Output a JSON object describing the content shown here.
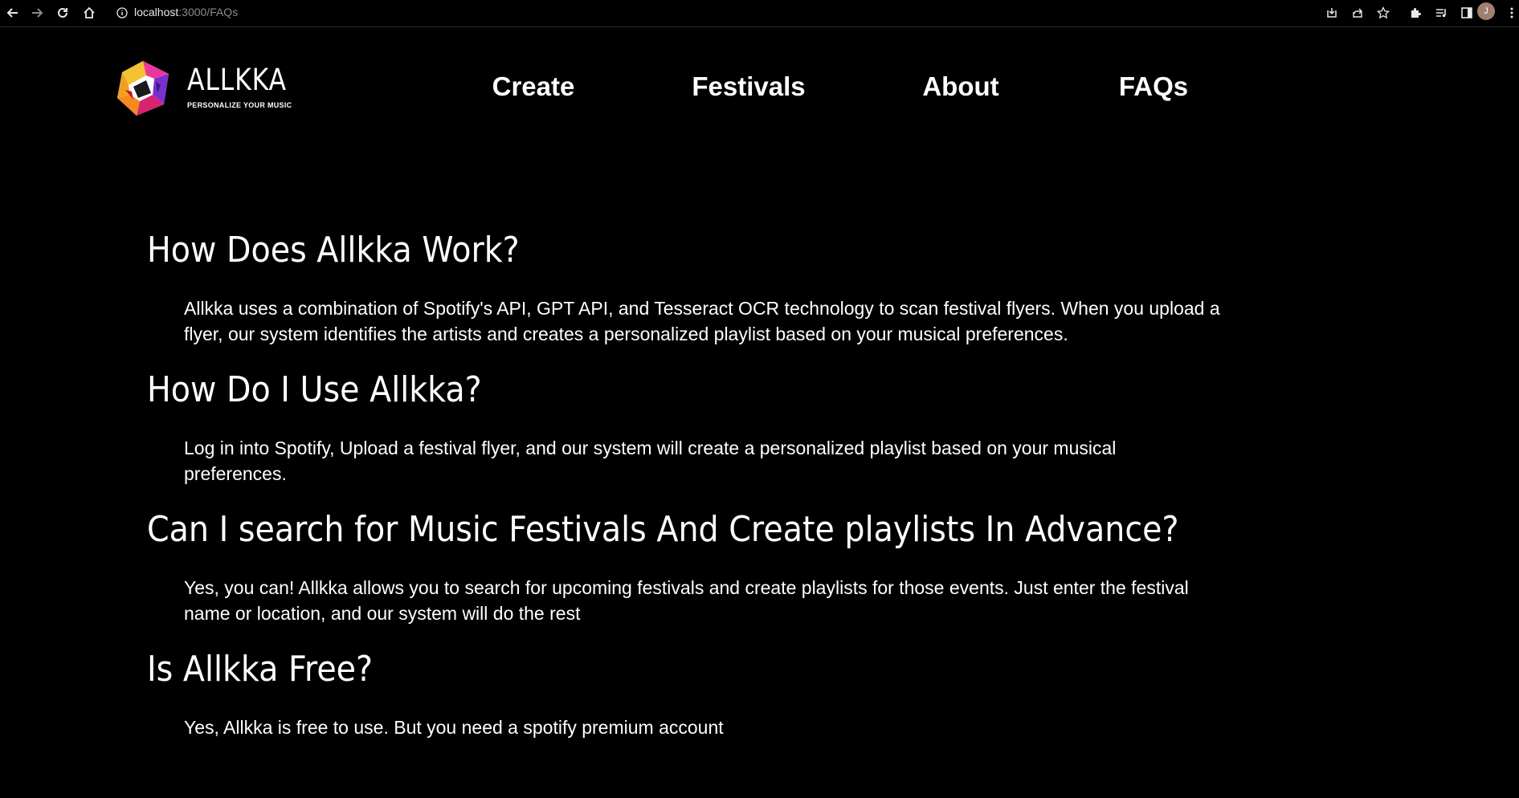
{
  "browser": {
    "url_host": "localhost",
    "url_path": ":3000/FAQs",
    "profile_initial": "J"
  },
  "header": {
    "logo_name": "ALLKKA",
    "logo_tagline": "PERSONALIZE YOUR MUSIC",
    "nav": [
      {
        "label": "Create"
      },
      {
        "label": "Festivals"
      },
      {
        "label": "About"
      },
      {
        "label": "FAQs"
      }
    ]
  },
  "faqs": [
    {
      "question": "How Does Allkka Work?",
      "answer": "Allkka uses a combination of Spotify's API, GPT API, and Tesseract OCR technology to scan festival flyers. When you upload a flyer, our system identifies the artists and creates a personalized playlist based on your musical preferences."
    },
    {
      "question": "How Do I Use Allkka?",
      "answer": "Log in into Spotify, Upload a festival flyer, and our system will create a personalized playlist based on your musical preferences."
    },
    {
      "question": "Can I search for Music Festivals And Create playlists In Advance?",
      "answer": "Yes, you can! Allkka allows you to search for upcoming festivals and create playlists for those events. Just enter the festival name or location, and our system will do the rest"
    },
    {
      "question": "Is Allkka Free?",
      "answer": "Yes, Allkka is free to use. But you need a spotify premium account"
    }
  ],
  "colors": {
    "background": "#000000",
    "text": "#ffffff"
  }
}
